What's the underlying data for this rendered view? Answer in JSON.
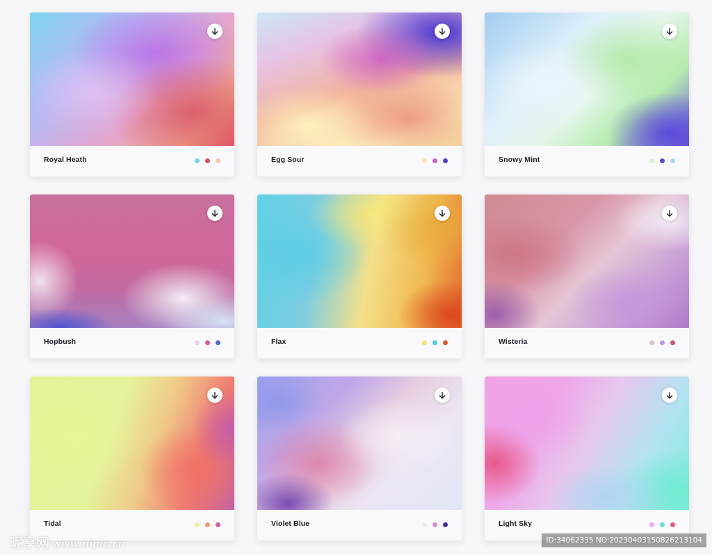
{
  "cards": [
    {
      "name": "Royal Heath",
      "swatches": [
        "#6fd3ee",
        "#d2506a",
        "#f7c9a8"
      ],
      "gradient": {
        "base": "linear-gradient(135deg, #7fd4f0 0%, #b9b8f2 35%, #e3a6cf 60%, #f0a78a 85%, #e55266 100%)",
        "layers": [
          "radial-gradient(ellipse 60% 55% at 62% 30%, rgba(178,100,235,0.75) 0%, rgba(178,100,235,0) 70%)",
          "radial-gradient(ellipse 55% 55% at 80% 75%, rgba(216,84,100,0.85) 0%, rgba(216,84,100,0) 75%)",
          "radial-gradient(ellipse 45% 45% at 30% 60%, rgba(232,196,246,0.7) 0%, rgba(232,196,246,0) 75%)"
        ]
      }
    },
    {
      "name": "Egg Sour",
      "swatches": [
        "#fbe8b4",
        "#cf63c0",
        "#4a3fd0"
      ],
      "gradient": {
        "base": "linear-gradient(160deg, #cde7f7 0%, #e6c4e6 25%, #f2b39c 55%, #fdefb8 85%, #f5d8a0 100%)",
        "layers": [
          "radial-gradient(ellipse 55% 45% at 90% 15%, rgba(66,48,214,0.95) 0%, rgba(66,48,214,0) 75%)",
          "radial-gradient(ellipse 40% 35% at 60% 35%, rgba(196,70,200,0.7) 0%, rgba(196,70,200,0) 75%)",
          "radial-gradient(ellipse 50% 40% at 75% 80%, rgba(230,120,110,0.65) 0%, rgba(230,120,110,0) 75%)",
          "radial-gradient(ellipse 45% 40% at 25% 85%, rgba(255,246,190,0.9) 0%, rgba(255,246,190,0) 75%)"
        ]
      }
    },
    {
      "name": "Snowy Mint",
      "swatches": [
        "#d8f2d2",
        "#5b4fd2",
        "#a9d7f6"
      ],
      "gradient": {
        "base": "linear-gradient(135deg, #a2cdf0 0%, #dff0fb 35%, #e4f6ea 55%, #b8ecb0 75%, #6a58d8 100%)",
        "layers": [
          "radial-gradient(ellipse 45% 45% at 70% 35%, rgba(174,232,160,0.85) 0%, rgba(174,232,160,0) 75%)",
          "radial-gradient(ellipse 40% 40% at 90% 90%, rgba(90,70,220,0.95) 0%, rgba(90,70,220,0) 75%)",
          "radial-gradient(ellipse 45% 45% at 30% 55%, rgba(235,246,253,0.9) 0%, rgba(235,246,253,0) 75%)"
        ]
      }
    },
    {
      "name": "Hopbush",
      "swatches": [
        "#e2d6e0",
        "#cf5f98",
        "#5467d6"
      ],
      "gradient": {
        "base": "linear-gradient(180deg, #c8709e 0%, #d2689a 45%, #c26aa0 70%, #a680c0 100%)",
        "layers": [
          "radial-gradient(ellipse 40% 35% at 75% 78%, rgba(246,244,250,0.95) 0%, rgba(246,244,250,0) 75%)",
          "radial-gradient(ellipse 25% 40% at 5% 65%, rgba(250,246,250,0.85) 0%, rgba(250,246,250,0) 75%)",
          "radial-gradient(ellipse 35% 20% at 15% 100%, rgba(70,80,210,0.95) 0%, rgba(70,80,210,0) 75%)",
          "radial-gradient(ellipse 40% 25% at 95% 95%, rgba(220,236,250,0.9) 0%, rgba(220,236,250,0) 75%)"
        ]
      }
    },
    {
      "name": "Flax",
      "swatches": [
        "#f3e07a",
        "#5dc8e6",
        "#e2572c"
      ],
      "gradient": {
        "base": "linear-gradient(100deg, #5fd0e6 0%, #7fcee0 30%, #f4e08a 55%, #f0b850 80%, #e46a2e 100%)",
        "layers": [
          "radial-gradient(ellipse 45% 50% at 20% 45%, rgba(90,206,230,0.9) 0%, rgba(90,206,230,0) 75%)",
          "radial-gradient(ellipse 40% 35% at 55% 15%, rgba(246,232,120,0.8) 0%, rgba(246,232,120,0) 75%)",
          "radial-gradient(ellipse 35% 35% at 95% 90%, rgba(218,70,30,0.95) 0%, rgba(218,70,30,0) 75%)",
          "radial-gradient(ellipse 40% 40% at 90% 25%, rgba(232,170,60,0.85) 0%, rgba(232,170,60,0) 75%)"
        ]
      }
    },
    {
      "name": "Wisteria",
      "swatches": [
        "#e0c0ce",
        "#b79be4",
        "#c95a78"
      ],
      "gradient": {
        "base": "linear-gradient(135deg, #d08a92 0%, #d897a8 35%, #e6c6d6 55%, #c49ad6 80%, #b07cc8 100%)",
        "layers": [
          "radial-gradient(ellipse 45% 40% at 15% 45%, rgba(205,110,125,0.8) 0%, rgba(205,110,125,0) 75%)",
          "radial-gradient(ellipse 35% 30% at 90% 20%, rgba(244,238,248,0.9) 0%, rgba(244,238,248,0) 75%)",
          "radial-gradient(ellipse 30% 35% at 5% 90%, rgba(140,80,170,0.8) 0%, rgba(140,80,170,0) 75%)",
          "radial-gradient(ellipse 40% 35% at 70% 80%, rgba(196,150,220,0.8) 0%, rgba(196,150,220,0) 75%)"
        ]
      }
    },
    {
      "name": "Tidal",
      "swatches": [
        "#eaf39a",
        "#eea06e",
        "#c9609c"
      ],
      "gradient": {
        "base": "linear-gradient(110deg, #e6f29a 0%, #e4f49c 40%, #f0c888 60%, #ee7c72 80%, #c661a0 100%)",
        "layers": [
          "radial-gradient(ellipse 45% 55% at 20% 45%, rgba(232,246,150,0.9) 0%, rgba(232,246,150,0) 75%)",
          "radial-gradient(ellipse 35% 45% at 80% 70%, rgba(240,110,100,0.85) 0%, rgba(240,110,100,0) 75%)",
          "radial-gradient(ellipse 25% 40% at 98% 40%, rgba(196,90,170,0.9) 0%, rgba(196,90,170,0) 75%)"
        ]
      }
    },
    {
      "name": "Violet Blue",
      "swatches": [
        "#eeeaf2",
        "#dc8ec0",
        "#4a2e9e"
      ],
      "gradient": {
        "base": "linear-gradient(135deg, #9aa0ec 0%, #c0a8e8 30%, #e8cfe0 50%, #ece6f2 70%, #dfe6f6 100%)",
        "layers": [
          "radial-gradient(ellipse 40% 45% at 30% 65%, rgba(220,120,160,0.8) 0%, rgba(220,120,160,0) 75%)",
          "radial-gradient(ellipse 30% 30% at 15% 95%, rgba(110,60,170,0.9) 0%, rgba(110,60,170,0) 75%)",
          "radial-gradient(ellipse 40% 40% at 70% 45%, rgba(246,240,248,0.9) 0%, rgba(246,240,248,0) 75%)",
          "radial-gradient(ellipse 30% 30% at 10% 20%, rgba(140,150,236,0.8) 0%, rgba(140,150,236,0) 75%)"
        ]
      }
    },
    {
      "name": "Light Sky",
      "swatches": [
        "#f0a6ea",
        "#6ae0d6",
        "#e8577c"
      ],
      "gradient": {
        "base": "linear-gradient(120deg, #f0a2e4 0%, #eea8e8 30%, #e6c8ee 50%, #b0e4f2 75%, #7eead8 100%)",
        "layers": [
          "radial-gradient(ellipse 30% 40% at 5% 65%, rgba(232,80,130,0.9) 0%, rgba(232,80,130,0) 75%)",
          "radial-gradient(ellipse 35% 40% at 25% 30%, rgba(240,160,236,0.8) 0%, rgba(240,160,236,0) 75%)",
          "radial-gradient(ellipse 40% 40% at 95% 85%, rgba(110,236,210,0.9) 0%, rgba(110,236,210,0) 75%)",
          "radial-gradient(ellipse 40% 30% at 60% 90%, rgba(176,210,240,0.8) 0%, rgba(176,210,240,0) 75%)"
        ]
      }
    }
  ],
  "watermark": {
    "left_text": "昵享网",
    "left_url": "www.nipic.cn",
    "right_text": "ID:34062335 NO:20230403150826213104"
  }
}
